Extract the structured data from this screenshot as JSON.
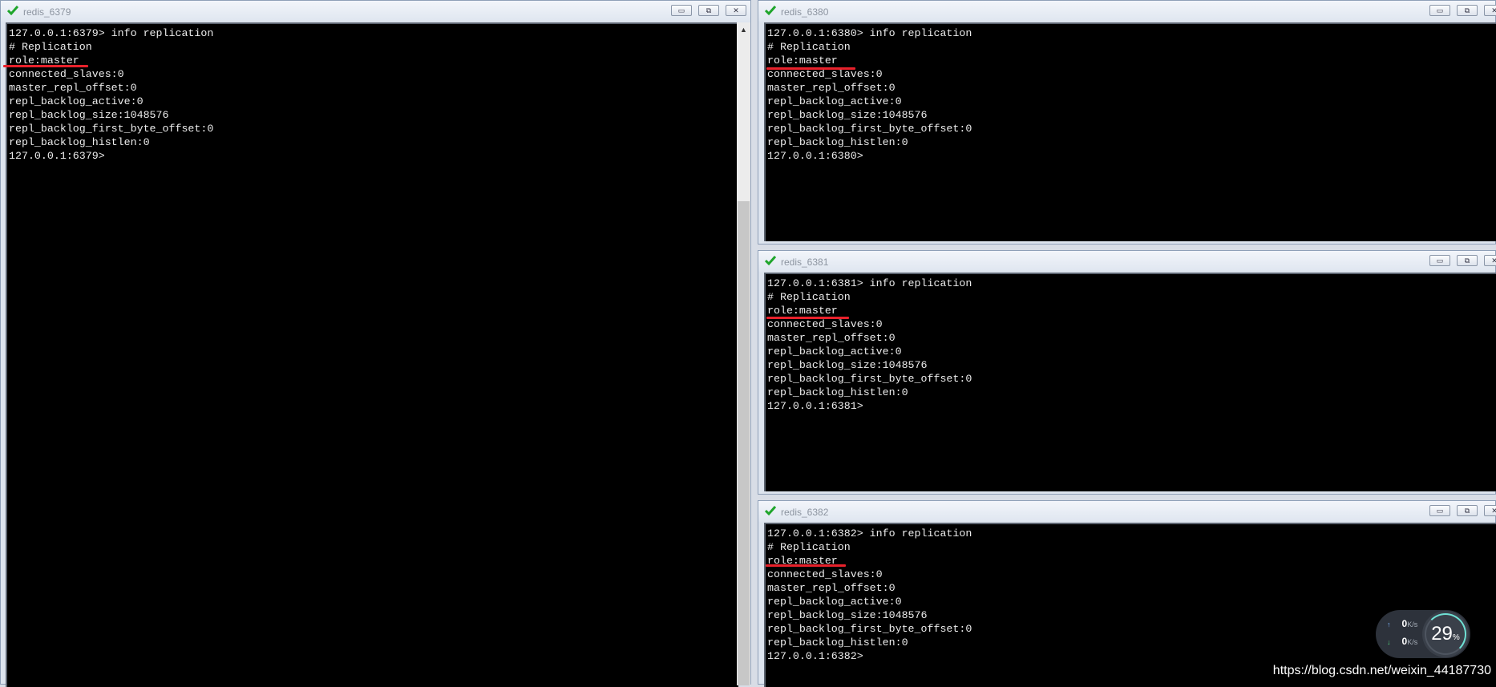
{
  "windows": [
    {
      "title": "redis_6379",
      "lines": [
        "127.0.0.1:6379> info replication",
        "# Replication",
        "role:master",
        "connected_slaves:0",
        "master_repl_offset:0",
        "repl_backlog_active:0",
        "repl_backlog_size:1048576",
        "repl_backlog_first_byte_offset:0",
        "repl_backlog_histlen:0",
        "127.0.0.1:6379>"
      ]
    },
    {
      "title": "redis_6380",
      "lines": [
        "127.0.0.1:6380> info replication",
        "# Replication",
        "role:master",
        "connected_slaves:0",
        "master_repl_offset:0",
        "repl_backlog_active:0",
        "repl_backlog_size:1048576",
        "repl_backlog_first_byte_offset:0",
        "repl_backlog_histlen:0",
        "127.0.0.1:6380>"
      ]
    },
    {
      "title": "redis_6381",
      "lines": [
        "127.0.0.1:6381> info replication",
        "# Replication",
        "role:master",
        "connected_slaves:0",
        "master_repl_offset:0",
        "repl_backlog_active:0",
        "repl_backlog_size:1048576",
        "repl_backlog_first_byte_offset:0",
        "repl_backlog_histlen:0",
        "127.0.0.1:6381>"
      ]
    },
    {
      "title": "redis_6382",
      "lines": [
        "127.0.0.1:6382> info replication",
        "# Replication",
        "role:master",
        "connected_slaves:0",
        "master_repl_offset:0",
        "repl_backlog_active:0",
        "repl_backlog_size:1048576",
        "repl_backlog_first_byte_offset:0",
        "repl_backlog_histlen:0",
        "127.0.0.1:6382>"
      ]
    }
  ],
  "window_controls": {
    "minimize_icon": "minimize-icon",
    "maximize_icon": "maximize-icon",
    "close_icon": "close-icon"
  },
  "status_icon": "green-check-icon",
  "annotation_color": "#e8212b",
  "network_widget": {
    "upload": "0",
    "upload_unit": "K/s",
    "download": "0",
    "download_unit": "K/s",
    "percent": "29",
    "percent_unit": "%"
  },
  "watermark": "https://blog.csdn.net/weixin_44187730"
}
